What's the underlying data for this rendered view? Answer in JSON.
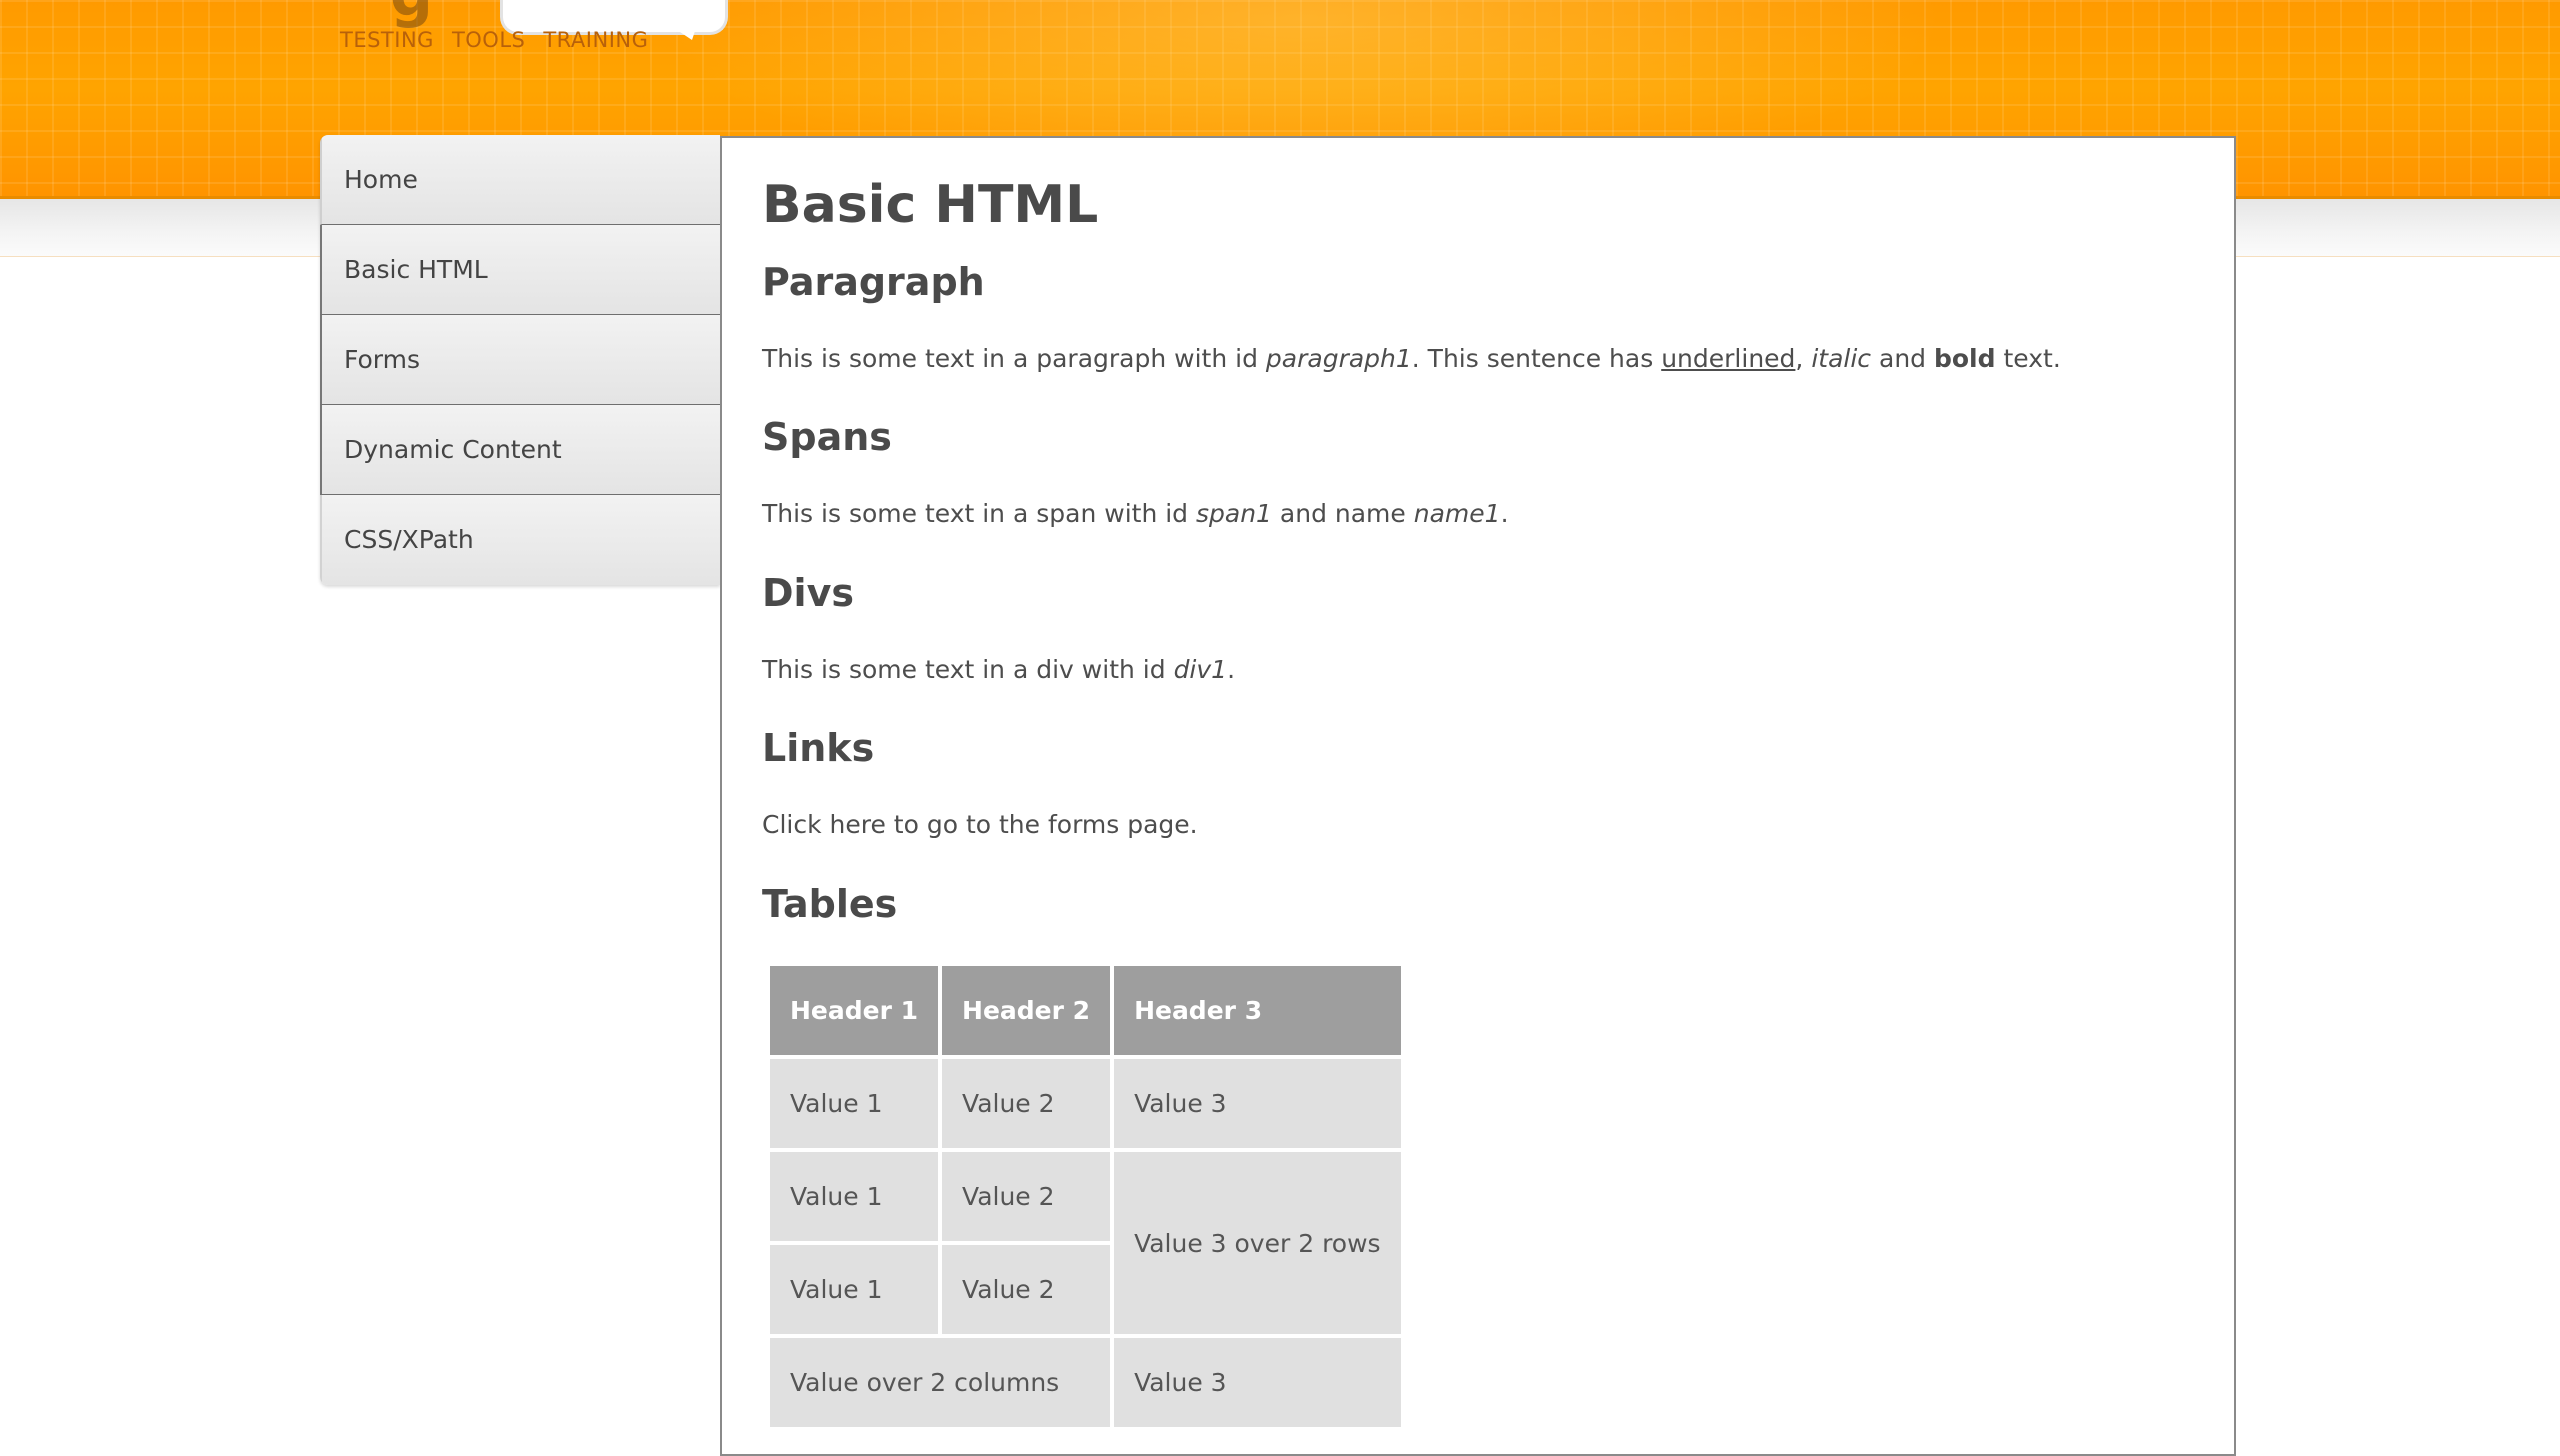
{
  "header": {
    "tagline": [
      "TESTING",
      "TOOLS",
      "TRAINING"
    ]
  },
  "nav": {
    "items": [
      {
        "label": "Home"
      },
      {
        "label": "Basic HTML"
      },
      {
        "label": "Forms"
      },
      {
        "label": "Dynamic Content"
      },
      {
        "label": "CSS/XPath"
      }
    ]
  },
  "page": {
    "title": "Basic HTML",
    "sections": {
      "paragraph": {
        "heading": "Paragraph",
        "text_1": "This is some text in a paragraph with id ",
        "id_value": "paragraph1",
        "text_2": ". This sentence has ",
        "underlined": "underlined",
        "text_3": ", ",
        "italic": "italic",
        "text_4": " and ",
        "bold": "bold",
        "text_5": " text."
      },
      "spans": {
        "heading": "Spans",
        "text_1": "This is some text in a span with id ",
        "id_value": "span1",
        "text_2": " and name ",
        "name_value": "name1",
        "text_3": "."
      },
      "divs": {
        "heading": "Divs",
        "text_1": "This is some text in a div with id ",
        "id_value": "div1",
        "text_2": "."
      },
      "links": {
        "heading": "Links",
        "link_text": "Click here",
        "text_after": " to go to the forms page."
      },
      "tables": {
        "heading": "Tables",
        "headers": [
          "Header 1",
          "Header 2",
          "Header 3"
        ],
        "rows": [
          [
            "Value 1",
            "Value 2",
            "Value 3"
          ],
          [
            "Value 1",
            "Value 2",
            "Value 3 over 2 rows"
          ],
          [
            "Value 1",
            "Value 2"
          ],
          [
            "Value over 2 columns",
            "Value 3"
          ]
        ]
      }
    }
  },
  "colors": {
    "header_orange": "#ff9900",
    "nav_bg": "#e8e8e8",
    "table_header_bg": "#9e9e9e",
    "table_cell_bg": "#e0e0e0",
    "text": "#4d4d4d"
  }
}
